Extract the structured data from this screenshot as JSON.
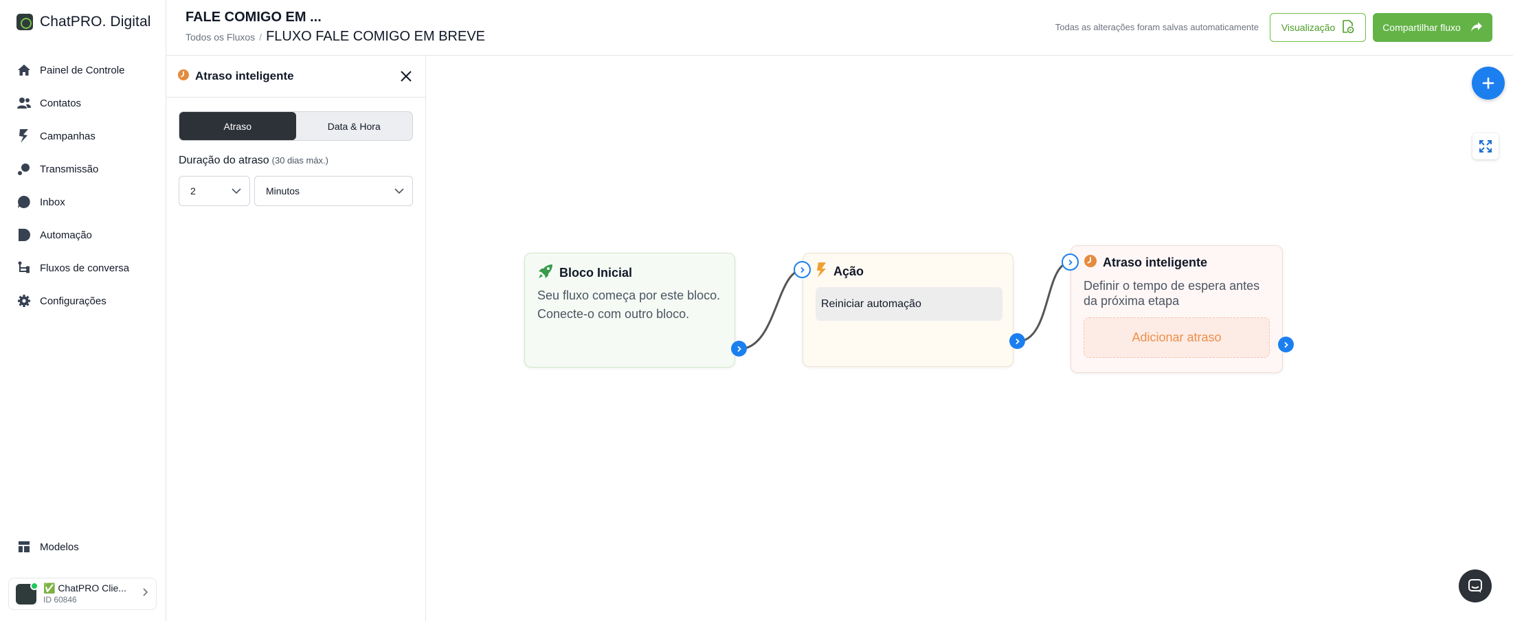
{
  "sidebar": {
    "brand": "ChatPRO. Digital",
    "items": [
      {
        "label": "Painel de Controle",
        "icon": "home-icon"
      },
      {
        "label": "Contatos",
        "icon": "users-icon"
      },
      {
        "label": "Campanhas",
        "icon": "bolt-icon"
      },
      {
        "label": "Transmissão",
        "icon": "broadcast-icon"
      },
      {
        "label": "Inbox",
        "icon": "chat-bubble-icon"
      },
      {
        "label": "Automação",
        "icon": "automation-icon"
      },
      {
        "label": "Fluxos de conversa",
        "icon": "flow-icon"
      },
      {
        "label": "Configurações",
        "icon": "gear-icon"
      }
    ],
    "bottom_item": {
      "label": "Modelos",
      "icon": "templates-icon"
    },
    "account": {
      "name": "✅ ChatPRO Clie...",
      "id": "ID 60846"
    }
  },
  "header": {
    "title": "FALE COMIGO EM ...",
    "breadcrumb_root": "Todos os Fluxos",
    "breadcrumb_sep": "/",
    "breadcrumb_current": "FLUXO FALE COMIGO EM BREVE",
    "autosave": "Todas as alterações foram salvas automaticamente",
    "preview_label": "Visualização",
    "share_label": "Compartilhar fluxo"
  },
  "panel": {
    "title": "Atraso inteligente",
    "tabs": [
      "Atraso",
      "Data & Hora"
    ],
    "active_tab": "Atraso",
    "duration_label": "Duração do atraso",
    "duration_hint": "(30 dias máx.)",
    "amount_value": "2",
    "unit_value": "Minutos"
  },
  "canvas": {
    "nodes": {
      "start": {
        "title": "Bloco Inicial",
        "desc_line1": "Seu fluxo começa por este bloco.",
        "desc_line2": "Conecte-o com outro bloco."
      },
      "action": {
        "title": "Ação",
        "chip": "Reiniciar automação"
      },
      "delay": {
        "title": "Atraso inteligente",
        "desc_line1": "Definir o tempo de espera antes",
        "desc_line2": "da próxima etapa",
        "add_label": "Adicionar atraso"
      }
    }
  },
  "colors": {
    "primary_blue": "#1c7ff0",
    "brand_green": "#63b347",
    "delay_orange": "#ed8f48",
    "dark": "#2d3138"
  }
}
